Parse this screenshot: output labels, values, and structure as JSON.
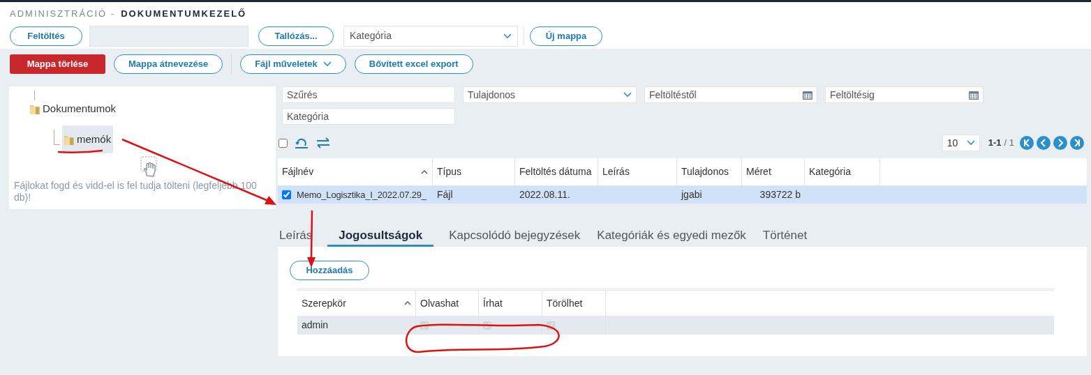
{
  "header": {
    "section": "ADMINISZTRÁCIÓ -",
    "title": "DOKUMENTUMKEZELŐ"
  },
  "upload_bar": {
    "upload_button": "Feltöltés",
    "browse_button": "Tallózás...",
    "category_select": {
      "placeholder": "Kategória"
    },
    "new_folder_button": "Új mappa"
  },
  "folder_actions": [
    {
      "kind": "danger",
      "label": "Mappa törlése"
    },
    {
      "kind": "outline",
      "label": "Mappa átnevezése"
    },
    {
      "kind": "dropdown",
      "label": "Fájl műveletek"
    },
    {
      "kind": "outline",
      "label": "Bővített excel export"
    }
  ],
  "tree": {
    "items": [
      {
        "label": "Dokumentumok",
        "selected": false,
        "children": [
          {
            "label": "memók",
            "selected": true
          }
        ]
      }
    ],
    "drop_hint": "Fájlokat fogd és vidd-el is fel tudja tölteni (legfeljebb 100 db)!"
  },
  "filters": [
    {
      "kind": "text",
      "placeholder": "Szűrés"
    },
    {
      "kind": "select",
      "placeholder": "Tulajdonos"
    },
    {
      "kind": "date",
      "placeholder": "Feltöltéstől"
    },
    {
      "kind": "date",
      "placeholder": "Feltöltésig"
    },
    {
      "kind": "text",
      "placeholder": "Kategória"
    }
  ],
  "list_toolbar": {
    "select_all_checked": false,
    "page_size": "10",
    "range": "1-1",
    "total": "/ 1"
  },
  "table": {
    "columns": [
      {
        "label": "Fájlnév",
        "sorted": true
      },
      {
        "label": "Típus",
        "sorted": false
      },
      {
        "label": "Feltöltés dátuma",
        "sorted": false
      },
      {
        "label": "Leírás",
        "sorted": false
      },
      {
        "label": "Tulajdonos",
        "sorted": false
      },
      {
        "label": "Méret",
        "sorted": false
      },
      {
        "label": "Kategória",
        "sorted": false
      }
    ],
    "rows": [
      {
        "checked": true,
        "selected": true,
        "cells": [
          "Memo_Logisztika_I_2022.07.29_",
          "Fájl",
          "2022.08.11.",
          "",
          "jgabi",
          "393722 b",
          ""
        ]
      }
    ]
  },
  "detail_tabs": [
    {
      "label": "Leírás",
      "selected": false
    },
    {
      "label": "Jogosultságok",
      "selected": true
    },
    {
      "label": "Kapcsolódó bejegyzések",
      "selected": false
    },
    {
      "label": "Kategóriák és egyedi mezők",
      "selected": false
    },
    {
      "label": "Történet",
      "selected": false
    }
  ],
  "permissions": {
    "add_button": "Hozzáadás",
    "columns": [
      {
        "label": "Szerepkör",
        "sorted": true
      },
      {
        "label": "Olvashat",
        "sorted": false
      },
      {
        "label": "Írhat",
        "sorted": false
      },
      {
        "label": "Törölhet",
        "sorted": false
      }
    ],
    "rows": [
      {
        "role": "admin",
        "disabled": true,
        "rights": [
          true,
          true,
          true
        ]
      }
    ]
  }
}
